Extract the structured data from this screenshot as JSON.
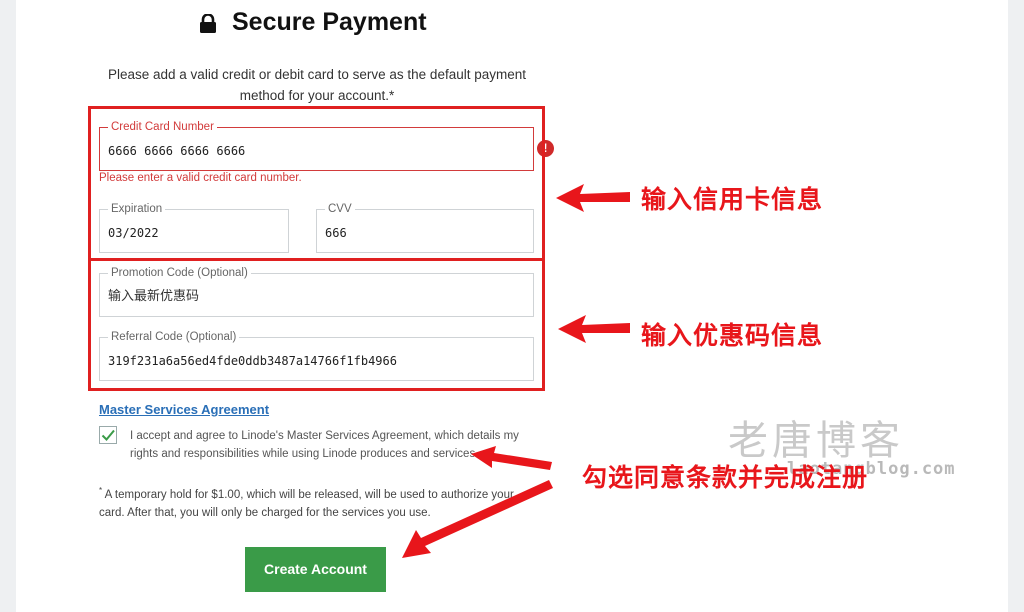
{
  "header": {
    "title": "Secure Payment",
    "lock_icon": "lock-icon"
  },
  "intro": "Please add a valid credit or debit card to serve as the default payment method for your account.*",
  "card": {
    "number_label": "Credit Card Number",
    "number_value": "6666 6666 6666 6666",
    "error": "Please enter a valid credit card number.",
    "error_icon": "!",
    "expiration_label": "Expiration",
    "expiration_value": "03/2022",
    "cvv_label": "CVV",
    "cvv_value": "666"
  },
  "promo": {
    "promo_label": "Promotion Code (Optional)",
    "promo_value": "输入最新优惠码",
    "referral_label": "Referral Code (Optional)",
    "referral_value": "319f231a6a56ed4fde0ddb3487a14766f1fb4966"
  },
  "agreement": {
    "link": "Master Services Agreement",
    "checked": true,
    "text": "I accept and agree to Linode's Master Services Agreement, which details my rights and responsibilities while using Linode produces and services.",
    "hold_star": "*",
    "hold_text": " A temporary hold for $1.00, which will be released, will be used to authorize your card. After that, you will only be charged for the services you use."
  },
  "button": {
    "create": "Create Account"
  },
  "annotations": {
    "card": "输入信用卡信息",
    "promo": "输入优惠码信息",
    "agree": "勾选同意条款并完成注册"
  },
  "watermark": {
    "main": "老唐博客",
    "sub": "laotangblog.com"
  },
  "colors": {
    "accent_green": "#3a9b48",
    "error_red": "#d23b3b",
    "annotation_red": "#e8161b",
    "link_blue": "#2a6fb7"
  }
}
